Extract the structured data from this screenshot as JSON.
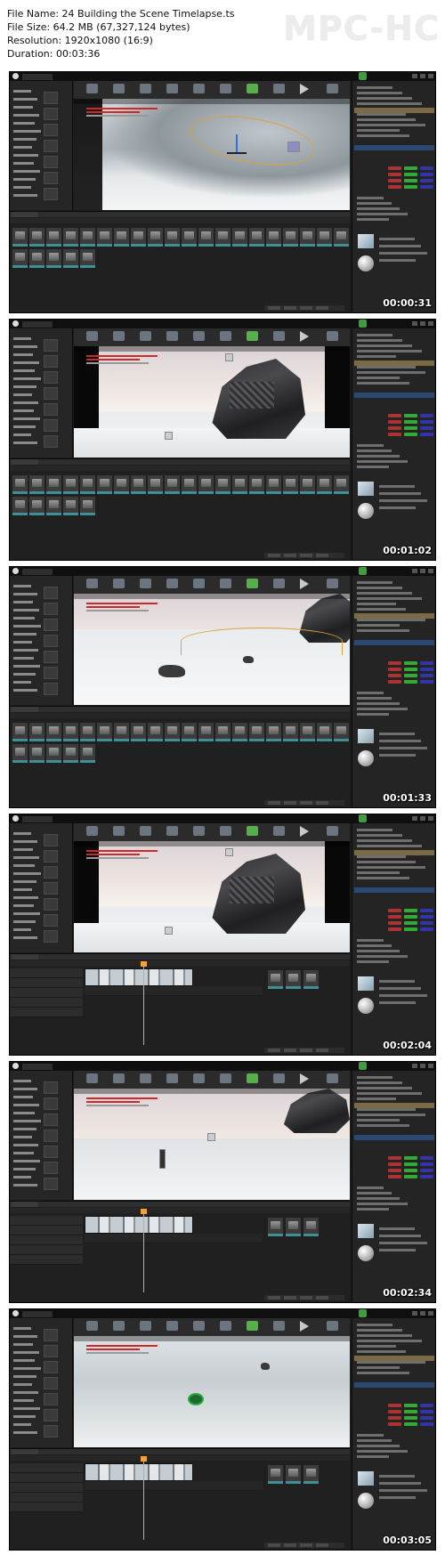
{
  "file_info": {
    "name_line": "File Name: 24 Building the Scene Timelapse.ts",
    "size_line": "File Size: 64.2 MB (67,327,124 bytes)",
    "resolution_line": "Resolution: 1920x1080 (16:9)",
    "duration_line": "Duration: 00:03:36"
  },
  "logo": "MPC-HC",
  "thumbnails": [
    {
      "timestamp": "00:00:31",
      "scene": "snow-spline",
      "bottom": "content-browser"
    },
    {
      "timestamp": "00:01:02",
      "scene": "spaceship",
      "bottom": "content-browser"
    },
    {
      "timestamp": "00:01:33",
      "scene": "snow-ridge",
      "bottom": "content-browser"
    },
    {
      "timestamp": "00:02:04",
      "scene": "spaceship",
      "bottom": "sequencer"
    },
    {
      "timestamp": "00:02:34",
      "scene": "wide-camera",
      "bottom": "sequencer"
    },
    {
      "timestamp": "00:03:05",
      "scene": "snow-top",
      "bottom": "sequencer"
    }
  ],
  "colors": {
    "editor_bg": "#1d1d1d",
    "accent_orange": "#f4a13a",
    "play_green": "#56b04a",
    "asset_teal": "#3f8f94",
    "error_red": "#cc2a2a"
  }
}
